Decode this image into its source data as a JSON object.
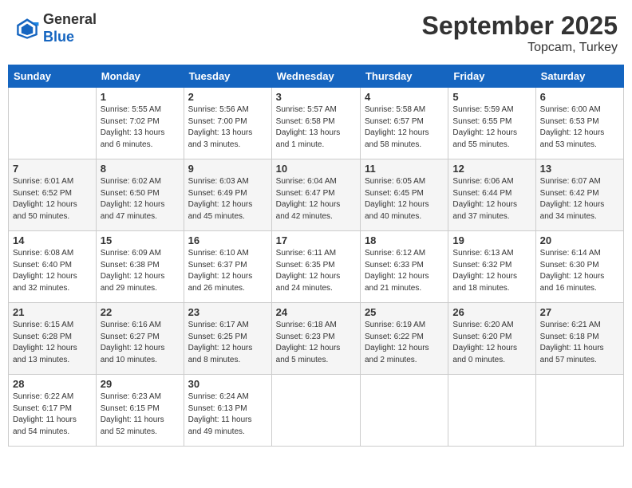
{
  "header": {
    "logo_general": "General",
    "logo_blue": "Blue",
    "month_year": "September 2025",
    "location": "Topcam, Turkey"
  },
  "weekdays": [
    "Sunday",
    "Monday",
    "Tuesday",
    "Wednesday",
    "Thursday",
    "Friday",
    "Saturday"
  ],
  "weeks": [
    [
      {
        "day": "",
        "info": ""
      },
      {
        "day": "1",
        "info": "Sunrise: 5:55 AM\nSunset: 7:02 PM\nDaylight: 13 hours\nand 6 minutes."
      },
      {
        "day": "2",
        "info": "Sunrise: 5:56 AM\nSunset: 7:00 PM\nDaylight: 13 hours\nand 3 minutes."
      },
      {
        "day": "3",
        "info": "Sunrise: 5:57 AM\nSunset: 6:58 PM\nDaylight: 13 hours\nand 1 minute."
      },
      {
        "day": "4",
        "info": "Sunrise: 5:58 AM\nSunset: 6:57 PM\nDaylight: 12 hours\nand 58 minutes."
      },
      {
        "day": "5",
        "info": "Sunrise: 5:59 AM\nSunset: 6:55 PM\nDaylight: 12 hours\nand 55 minutes."
      },
      {
        "day": "6",
        "info": "Sunrise: 6:00 AM\nSunset: 6:53 PM\nDaylight: 12 hours\nand 53 minutes."
      }
    ],
    [
      {
        "day": "7",
        "info": "Sunrise: 6:01 AM\nSunset: 6:52 PM\nDaylight: 12 hours\nand 50 minutes."
      },
      {
        "day": "8",
        "info": "Sunrise: 6:02 AM\nSunset: 6:50 PM\nDaylight: 12 hours\nand 47 minutes."
      },
      {
        "day": "9",
        "info": "Sunrise: 6:03 AM\nSunset: 6:49 PM\nDaylight: 12 hours\nand 45 minutes."
      },
      {
        "day": "10",
        "info": "Sunrise: 6:04 AM\nSunset: 6:47 PM\nDaylight: 12 hours\nand 42 minutes."
      },
      {
        "day": "11",
        "info": "Sunrise: 6:05 AM\nSunset: 6:45 PM\nDaylight: 12 hours\nand 40 minutes."
      },
      {
        "day": "12",
        "info": "Sunrise: 6:06 AM\nSunset: 6:44 PM\nDaylight: 12 hours\nand 37 minutes."
      },
      {
        "day": "13",
        "info": "Sunrise: 6:07 AM\nSunset: 6:42 PM\nDaylight: 12 hours\nand 34 minutes."
      }
    ],
    [
      {
        "day": "14",
        "info": "Sunrise: 6:08 AM\nSunset: 6:40 PM\nDaylight: 12 hours\nand 32 minutes."
      },
      {
        "day": "15",
        "info": "Sunrise: 6:09 AM\nSunset: 6:38 PM\nDaylight: 12 hours\nand 29 minutes."
      },
      {
        "day": "16",
        "info": "Sunrise: 6:10 AM\nSunset: 6:37 PM\nDaylight: 12 hours\nand 26 minutes."
      },
      {
        "day": "17",
        "info": "Sunrise: 6:11 AM\nSunset: 6:35 PM\nDaylight: 12 hours\nand 24 minutes."
      },
      {
        "day": "18",
        "info": "Sunrise: 6:12 AM\nSunset: 6:33 PM\nDaylight: 12 hours\nand 21 minutes."
      },
      {
        "day": "19",
        "info": "Sunrise: 6:13 AM\nSunset: 6:32 PM\nDaylight: 12 hours\nand 18 minutes."
      },
      {
        "day": "20",
        "info": "Sunrise: 6:14 AM\nSunset: 6:30 PM\nDaylight: 12 hours\nand 16 minutes."
      }
    ],
    [
      {
        "day": "21",
        "info": "Sunrise: 6:15 AM\nSunset: 6:28 PM\nDaylight: 12 hours\nand 13 minutes."
      },
      {
        "day": "22",
        "info": "Sunrise: 6:16 AM\nSunset: 6:27 PM\nDaylight: 12 hours\nand 10 minutes."
      },
      {
        "day": "23",
        "info": "Sunrise: 6:17 AM\nSunset: 6:25 PM\nDaylight: 12 hours\nand 8 minutes."
      },
      {
        "day": "24",
        "info": "Sunrise: 6:18 AM\nSunset: 6:23 PM\nDaylight: 12 hours\nand 5 minutes."
      },
      {
        "day": "25",
        "info": "Sunrise: 6:19 AM\nSunset: 6:22 PM\nDaylight: 12 hours\nand 2 minutes."
      },
      {
        "day": "26",
        "info": "Sunrise: 6:20 AM\nSunset: 6:20 PM\nDaylight: 12 hours\nand 0 minutes."
      },
      {
        "day": "27",
        "info": "Sunrise: 6:21 AM\nSunset: 6:18 PM\nDaylight: 11 hours\nand 57 minutes."
      }
    ],
    [
      {
        "day": "28",
        "info": "Sunrise: 6:22 AM\nSunset: 6:17 PM\nDaylight: 11 hours\nand 54 minutes."
      },
      {
        "day": "29",
        "info": "Sunrise: 6:23 AM\nSunset: 6:15 PM\nDaylight: 11 hours\nand 52 minutes."
      },
      {
        "day": "30",
        "info": "Sunrise: 6:24 AM\nSunset: 6:13 PM\nDaylight: 11 hours\nand 49 minutes."
      },
      {
        "day": "",
        "info": ""
      },
      {
        "day": "",
        "info": ""
      },
      {
        "day": "",
        "info": ""
      },
      {
        "day": "",
        "info": ""
      }
    ]
  ]
}
